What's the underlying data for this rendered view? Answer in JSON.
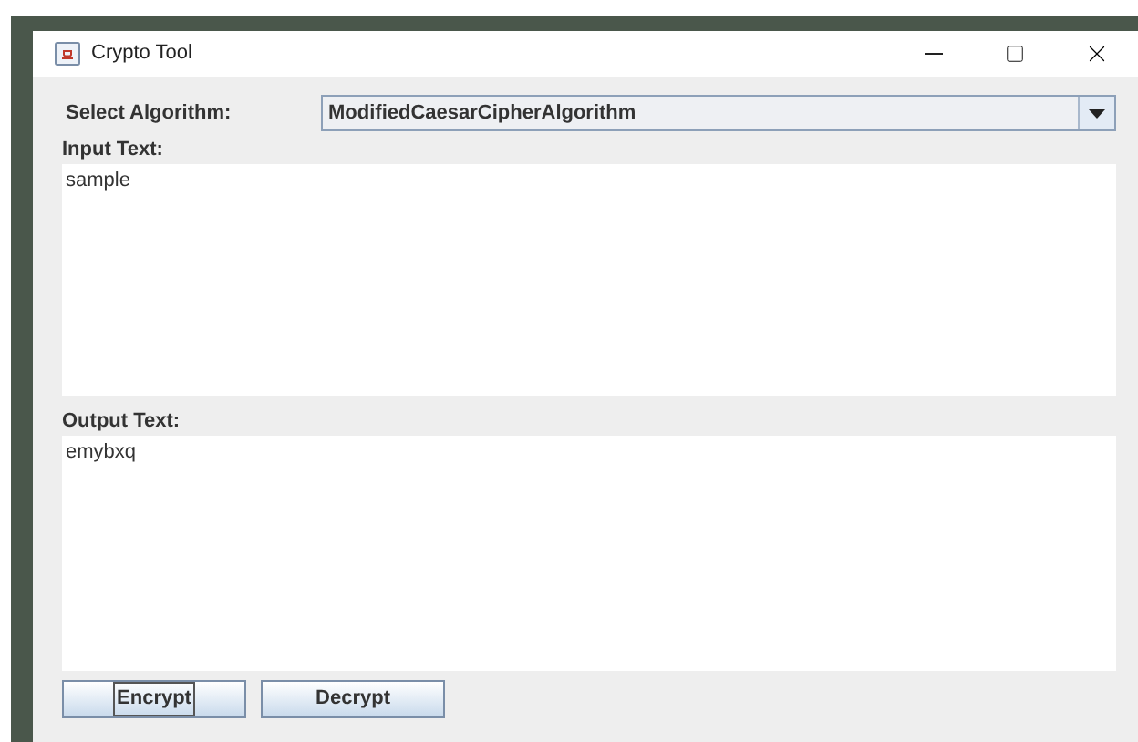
{
  "window": {
    "title": "Crypto Tool"
  },
  "algorithm": {
    "label": "Select Algorithm:",
    "value": "ModifiedCaesarCipherAlgorithm"
  },
  "input": {
    "label": "Input Text:",
    "value": "sample"
  },
  "output": {
    "label": "Output Text:",
    "value": "emybxq"
  },
  "buttons": [
    {
      "label": "Encrypt",
      "focused": true
    },
    {
      "label": "Decrypt",
      "focused": false
    }
  ]
}
